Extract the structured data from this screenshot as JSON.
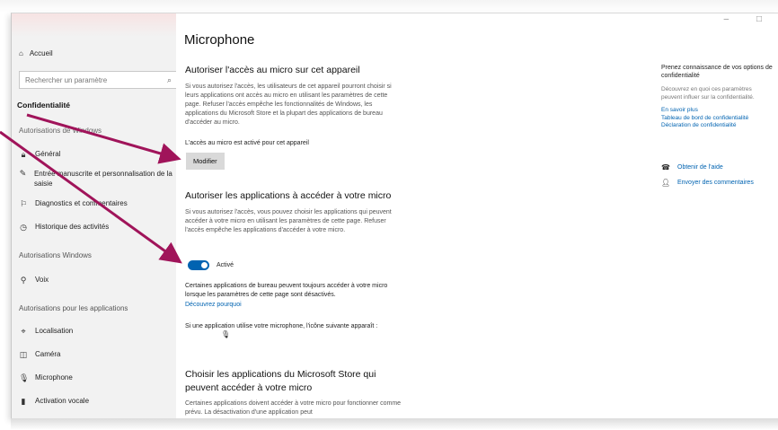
{
  "sidebar": {
    "home_label": "Accueil",
    "search_placeholder": "Rechercher un paramètre",
    "section_title": "Confidentialité",
    "group_windows": "Autorisations de Windows",
    "windows_items": [
      {
        "label": "Général",
        "icon": "lock-icon"
      },
      {
        "label": "Entrée manuscrite et personnalisation de la saisie",
        "icon": "pen-icon"
      },
      {
        "label": "Diagnostics et commentaires",
        "icon": "feedback-icon"
      },
      {
        "label": "Historique des activités",
        "icon": "history-icon"
      }
    ],
    "group_windows_perms": "Autorisations Windows",
    "voice_item": "Voix",
    "group_apps": "Autorisations pour les applications",
    "app_items": [
      {
        "label": "Localisation",
        "icon": "location-icon"
      },
      {
        "label": "Caméra",
        "icon": "camera-icon"
      },
      {
        "label": "Microphone",
        "icon": "microphone-icon"
      },
      {
        "label": "Activation vocale",
        "icon": "voice-activation-icon"
      }
    ]
  },
  "main": {
    "title": "Microphone",
    "section1_heading": "Autoriser l'accès au micro sur cet appareil",
    "section1_text": "Si vous autorisez l'accès, les utilisateurs de cet appareil pourront choisir si leurs applications ont accès au micro en utilisant les paramètres de cette page. Refuser l'accès empêche les fonctionnalités de Windows, les applications du Microsoft Store et la plupart des applications de bureau d'accéder au micro.",
    "device_status": "L'accès au micro est activé pour cet appareil",
    "modify_button": "Modifier",
    "section2_heading": "Autoriser les applications à accéder à votre micro",
    "section2_text": "Si vous autorisez l'accès, vous pouvez choisir les applications qui peuvent accéder à votre micro en utilisant les paramètres de cette page. Refuser l'accès empêche les applications d'accéder à votre micro.",
    "toggle_label": "Activé",
    "toggle_on": true,
    "desktop_note": "Certaines applications de bureau peuvent toujours accéder à votre micro lorsque les paramètres de cette page sont désactivés.",
    "learn_why_link": "Découvrez pourquoi",
    "icon_note": "Si une application utilise votre microphone, l'icône suivante apparaît :",
    "section3_heading": "Choisir les applications du Microsoft Store qui peuvent accéder à votre micro",
    "section3_text": "Certaines applications doivent accéder à votre micro pour fonctionner comme prévu. La désactivation d'une application peut"
  },
  "right": {
    "title": "Prenez connaissance de vos options de confidentialité",
    "text": "Découvrez en quoi ces paramètres peuvent influer sur la confidentialité.",
    "links": [
      "En savoir plus",
      "Tableau de bord de confidentialité",
      "Déclaration de confidentialité"
    ],
    "help_link": "Obtenir de l'aide",
    "feedback_link": "Envoyer des commentaires"
  },
  "colors": {
    "accent": "#0063b1",
    "annotation_arrow": "#a0145a",
    "sidebar_bg": "#f2f2f2"
  }
}
